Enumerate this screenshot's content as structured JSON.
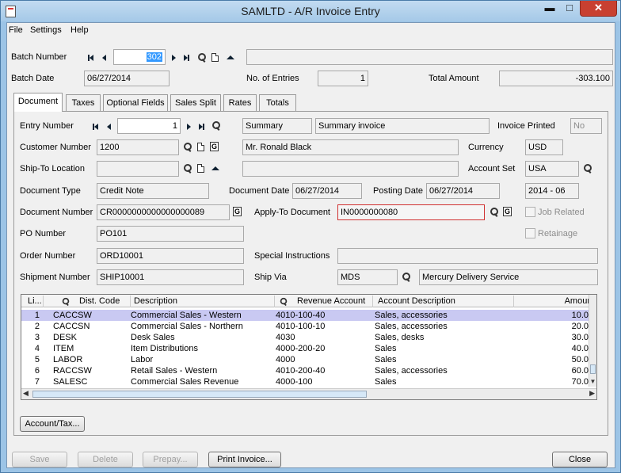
{
  "window": {
    "title": "SAMLTD - A/R Invoice Entry",
    "minimize": "▬",
    "maximize": "□",
    "close": "✕"
  },
  "menu": [
    "File",
    "Settings",
    "Help"
  ],
  "header": {
    "batch_number_label": "Batch Number",
    "batch_number": "302",
    "batch_desc": "",
    "batch_date_label": "Batch Date",
    "batch_date": "06/27/2014",
    "entries_label": "No. of Entries",
    "entries": "1",
    "total_label": "Total Amount",
    "total": "-303.100"
  },
  "tabs": [
    "Document",
    "Taxes",
    "Optional Fields",
    "Sales Split",
    "Rates",
    "Totals"
  ],
  "document": {
    "entry_number_label": "Entry Number",
    "entry_number": "1",
    "entry_type": "Summary",
    "entry_desc": "Summary invoice",
    "invoice_printed_label": "Invoice Printed",
    "invoice_printed": "No",
    "customer_number_label": "Customer Number",
    "customer_number": "1200",
    "customer_name": "Mr. Ronald Black",
    "currency_label": "Currency",
    "currency": "USD",
    "ship_to_label": "Ship-To Location",
    "ship_to": "",
    "ship_to_desc": "",
    "account_set_label": "Account Set",
    "account_set": "USA",
    "doc_type_label": "Document Type",
    "doc_type": "Credit Note",
    "doc_date_label": "Document Date",
    "doc_date": "06/27/2014",
    "posting_date_label": "Posting Date",
    "posting_date": "06/27/2014",
    "period": "2014 - 06",
    "doc_number_label": "Document Number",
    "doc_number": "CR0000000000000000089",
    "apply_to_label": "Apply-To Document",
    "apply_to": "IN0000000080",
    "job_related_label": "Job Related",
    "po_number_label": "PO Number",
    "po_number": "PO101",
    "retainage_label": "Retainage",
    "order_number_label": "Order Number",
    "order_number": "ORD10001",
    "special_instr_label": "Special Instructions",
    "special_instr": "",
    "shipment_number_label": "Shipment Number",
    "shipment_number": "SHIP10001",
    "ship_via_label": "Ship Via",
    "ship_via": "MDS",
    "ship_via_desc": "Mercury Delivery Service"
  },
  "grid": {
    "headers": [
      "Li...",
      "Dist. Code",
      "Description",
      "Revenue Account",
      "Account Description",
      "Amour"
    ],
    "rows": [
      {
        "line": "1",
        "code": "CACCSW",
        "desc": "Commercial Sales - Western",
        "account": "4010-100-40",
        "acct_desc": "Sales, accessories",
        "amount": "10.0"
      },
      {
        "line": "2",
        "code": "CACCSN",
        "desc": "Commercial Sales - Northern",
        "account": "4010-100-10",
        "acct_desc": "Sales, accessories",
        "amount": "20.0"
      },
      {
        "line": "3",
        "code": "DESK",
        "desc": "Desk Sales",
        "account": "4030",
        "acct_desc": "Sales, desks",
        "amount": "30.0"
      },
      {
        "line": "4",
        "code": "ITEM",
        "desc": "Item Distributions",
        "account": "4000-200-20",
        "acct_desc": "Sales",
        "amount": "40.0"
      },
      {
        "line": "5",
        "code": "LABOR",
        "desc": "Labor",
        "account": "4000",
        "acct_desc": "Sales",
        "amount": "50.0"
      },
      {
        "line": "6",
        "code": "RACCSW",
        "desc": "Retail Sales - Western",
        "account": "4010-200-40",
        "acct_desc": "Sales, accessories",
        "amount": "60.0"
      },
      {
        "line": "7",
        "code": "SALESC",
        "desc": "Commercial Sales Revenue",
        "account": "4000-100",
        "acct_desc": "Sales",
        "amount": "70.0"
      }
    ]
  },
  "buttons": {
    "account_tax": "Account/Tax...",
    "save": "Save",
    "delete": "Delete",
    "prepay": "Prepay...",
    "print_invoice": "Print Invoice...",
    "close": "Close"
  }
}
